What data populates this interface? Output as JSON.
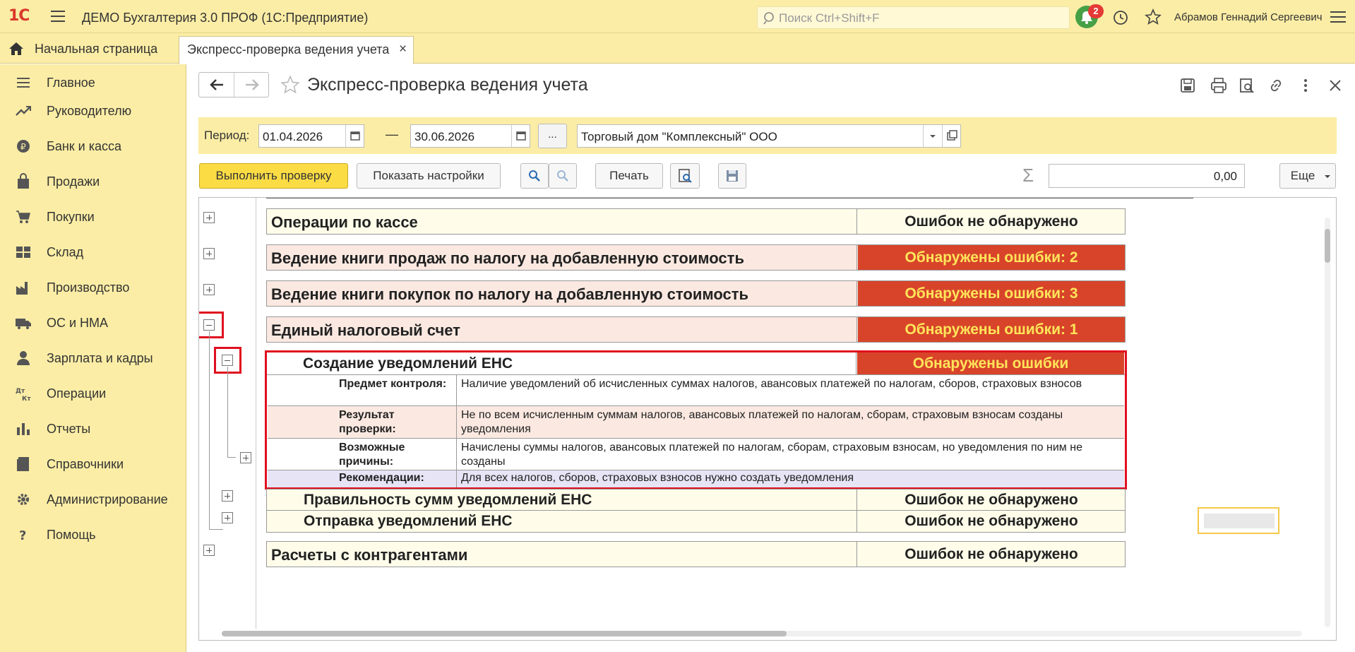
{
  "app": {
    "logo": "1С",
    "title": "ДЕМО Бухгалтерия 3.0 ПРОФ  (1С:Предприятие)"
  },
  "search": {
    "placeholder": "Поиск Ctrl+Shift+F"
  },
  "notifications": {
    "count": "2"
  },
  "user": {
    "name": "Абрамов Геннадий Сергеевич"
  },
  "tabs": {
    "home": "Начальная страница",
    "active": "Экспресс-проверка ведения учета",
    "close": "×"
  },
  "sidebar": {
    "items": [
      {
        "label": "Главное",
        "icon": "menu-icon"
      },
      {
        "label": "Руководителю",
        "icon": "trend-icon"
      },
      {
        "label": "Банк и касса",
        "icon": "coin-icon"
      },
      {
        "label": "Продажи",
        "icon": "bag-icon"
      },
      {
        "label": "Покупки",
        "icon": "cart-icon"
      },
      {
        "label": "Склад",
        "icon": "warehouse-icon"
      },
      {
        "label": "Производство",
        "icon": "factory-icon"
      },
      {
        "label": "ОС и НМА",
        "icon": "truck-icon"
      },
      {
        "label": "Зарплата и кадры",
        "icon": "person-icon"
      },
      {
        "label": "Операции",
        "icon": "dt-kt-icon"
      },
      {
        "label": "Отчеты",
        "icon": "bar-chart-icon"
      },
      {
        "label": "Справочники",
        "icon": "book-icon"
      },
      {
        "label": "Администрирование",
        "icon": "gear-icon"
      },
      {
        "label": "Помощь",
        "icon": "question-icon"
      }
    ]
  },
  "form": {
    "title": "Экспресс-проверка ведения учета"
  },
  "filter": {
    "period_label": "Период:",
    "date_from": "01.04.2026",
    "dash": "—",
    "date_to": "30.06.2026",
    "dots": "...",
    "organization": "Торговый дом \"Комплексный\" ООО"
  },
  "commands": {
    "run": "Выполнить проверку",
    "settings": "Показать настройки",
    "print": "Печать",
    "sum": "0,00",
    "more": "Еще"
  },
  "report": {
    "rows": [
      {
        "name": "Операции по кассе",
        "status": "Ошибок не обнаружено",
        "state": "ok"
      },
      {
        "name": "Ведение книги продаж по налогу на добавленную стоимость",
        "status": "Обнаружены ошибки: 2",
        "state": "err"
      },
      {
        "name": "Ведение книги покупок по налогу на добавленную стоимость",
        "status": "Обнаружены ошибки: 3",
        "state": "err"
      },
      {
        "name": "Единый налоговый счет",
        "status": "Обнаружены ошибки: 1",
        "state": "err"
      }
    ],
    "sub_error": {
      "name": "Создание уведомлений ЕНС",
      "status": "Обнаружены ошибки"
    },
    "details": [
      {
        "label": "Предмет контроля:",
        "value": "Наличие уведомлений об исчисленных суммах налогов, авансовых платежей по налогам, сборов, страховых взносов"
      },
      {
        "label": "Результат проверки:",
        "value": "Не по всем исчисленным суммам налогов, авансовых платежей по налогам, сборам, страховым взносам созданы уведомления"
      },
      {
        "label": "Возможные причины:",
        "value": "Начислены суммы налогов, авансовых платежей по налогам, сборам, страховым взносам, но уведомления по ним не созданы"
      },
      {
        "label": "Рекомендации:",
        "value": "Для всех налогов, сборов, страховых взносов нужно создать уведомления"
      }
    ],
    "sub_ok": [
      {
        "name": "Правильность сумм уведомлений ЕНС",
        "status": "Ошибок не обнаружено"
      },
      {
        "name": "Отправка уведомлений ЕНС",
        "status": "Ошибок не обнаружено"
      }
    ],
    "last": {
      "name": "Расчеты с контрагентами",
      "status": "Ошибок не обнаружено"
    }
  },
  "colors": {
    "panel": "#fbeda5",
    "error_bg": "#d8442a",
    "error_text": "#ffe55a",
    "highlight": "#e0101f"
  }
}
